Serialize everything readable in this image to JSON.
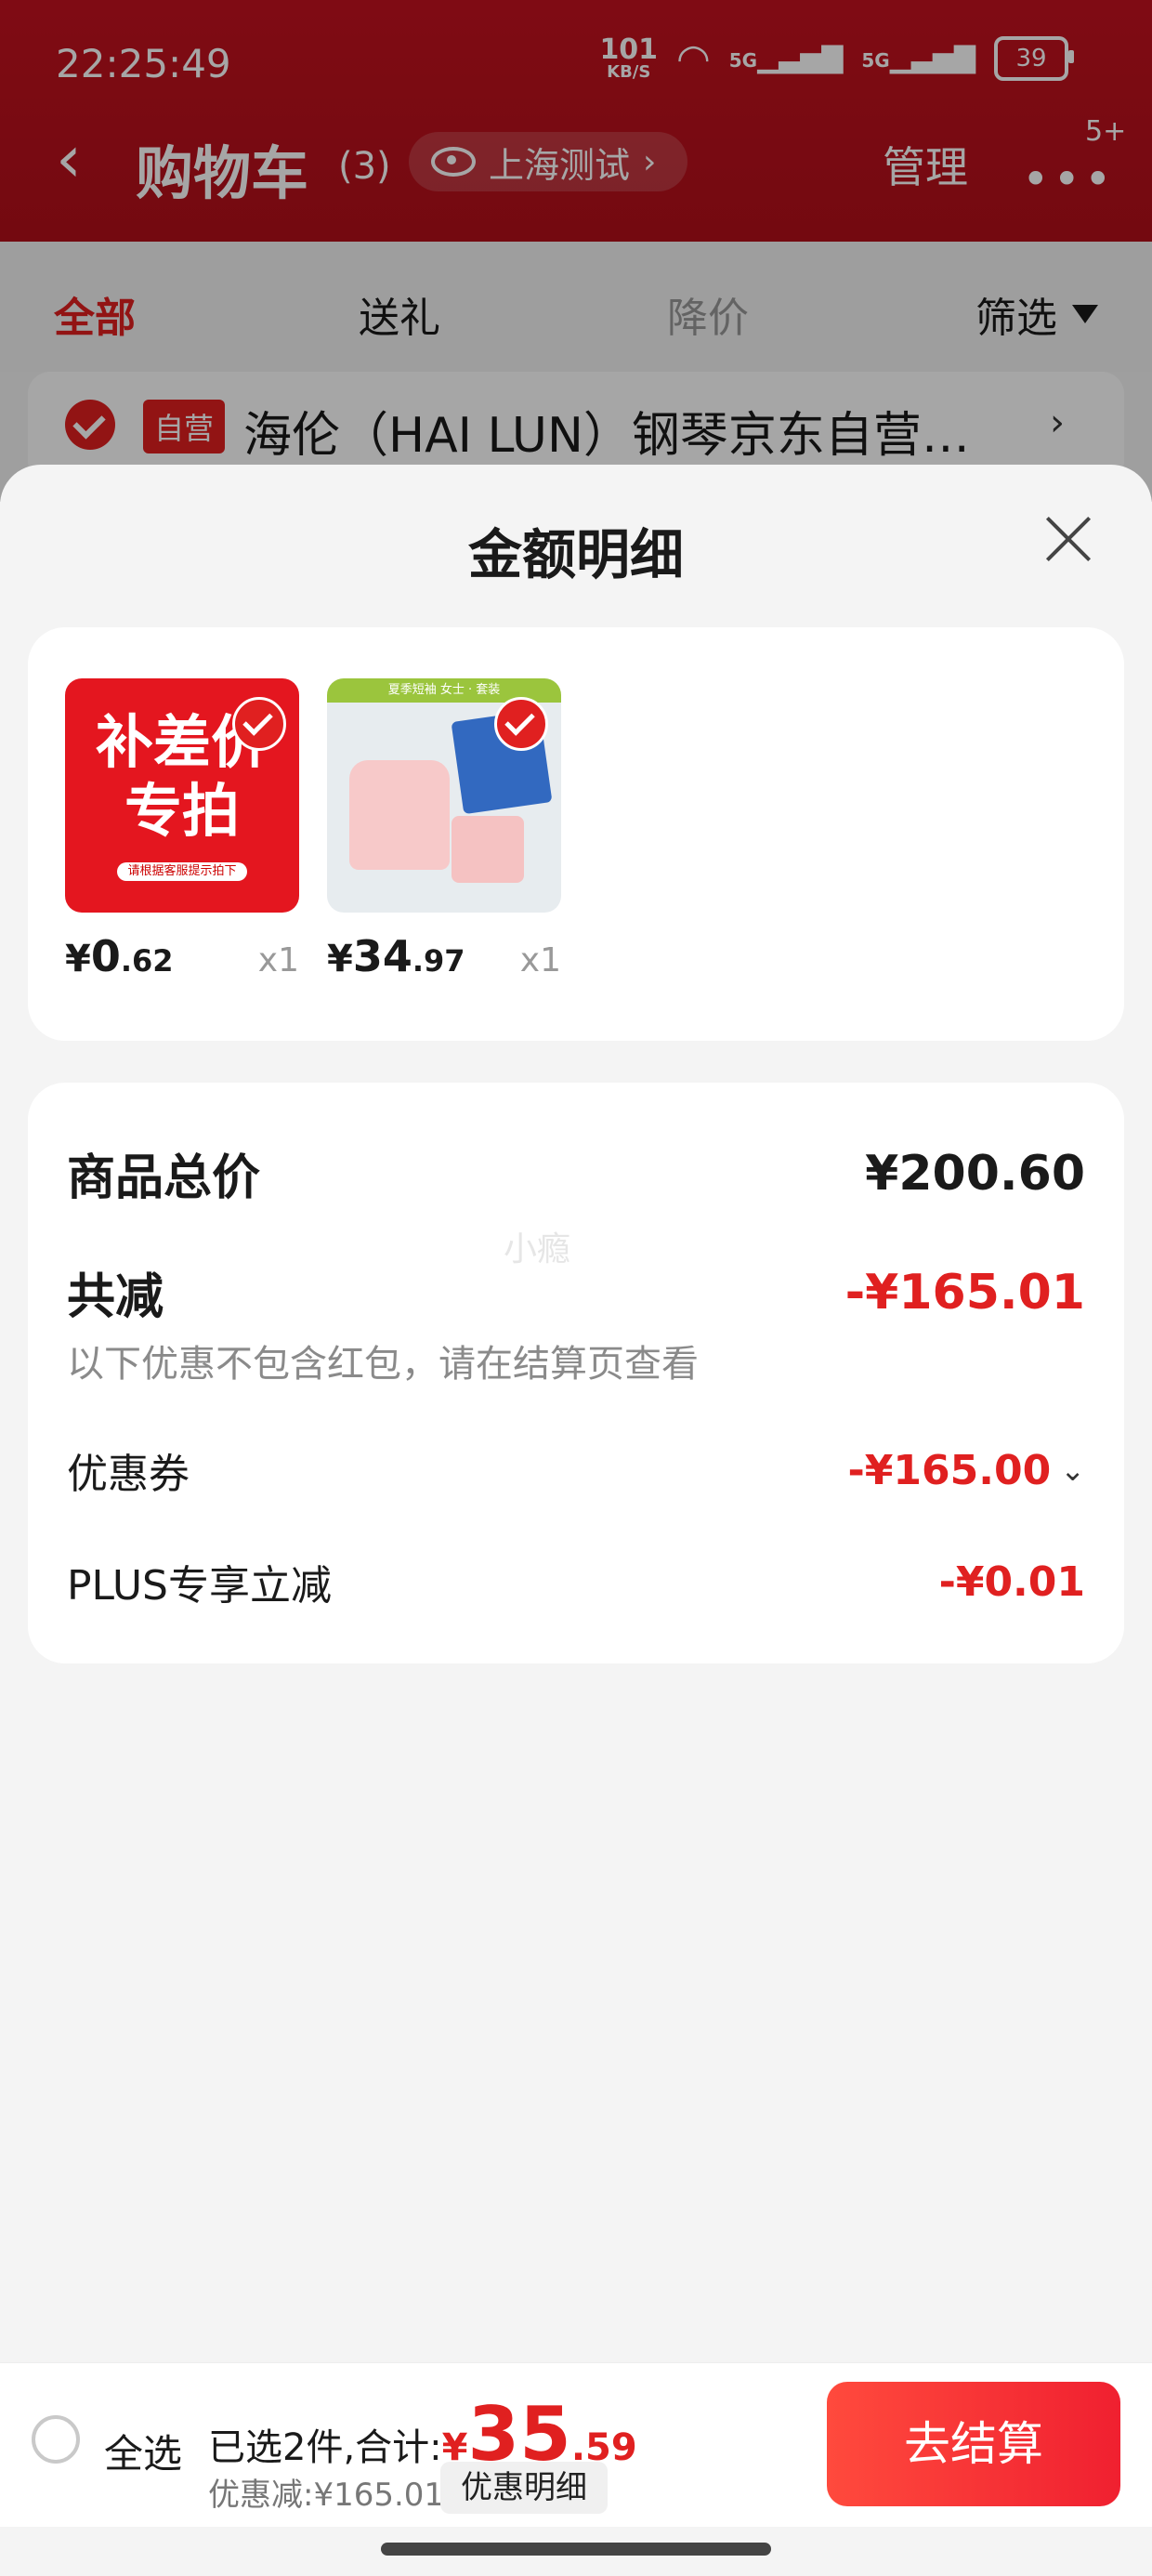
{
  "status_bar": {
    "time": "22:25:49",
    "net_speed_top": "101",
    "net_speed_unit": "KB/S",
    "signal1": "5G",
    "signal2": "5G",
    "battery": "39"
  },
  "header": {
    "back_icon": "chevron-left-icon",
    "title": "购物车",
    "count": "(3)",
    "location": "上海测试",
    "manage": "管理",
    "badge": "5+"
  },
  "tabs": [
    {
      "label": "全部",
      "state": "active"
    },
    {
      "label": "送礼",
      "state": "normal"
    },
    {
      "label": "降价",
      "state": "muted"
    },
    {
      "label": "筛选",
      "state": "normal"
    }
  ],
  "store": {
    "badge": "自营",
    "name": "海伦（HAI LUN）钢琴京东自营…"
  },
  "sheet": {
    "title": "金额明细",
    "products": [
      {
        "thumb_text_1": "补差价",
        "thumb_text_2": "专拍",
        "thumb_note": "请根据客服提示拍下",
        "price_yen": "¥",
        "price_int": "0",
        "price_cents": ".62",
        "qty": "x1"
      },
      {
        "thumb_band": "夏季短袖 女士 · 套装",
        "price_yen": "¥",
        "price_int": "34",
        "price_cents": ".97",
        "qty": "x1"
      }
    ],
    "summary": {
      "total_label": "商品总价",
      "total_value": "¥200.60",
      "watermark": "小瘾",
      "reduce_label": "共减",
      "reduce_value": "-¥165.01",
      "note": "以下优惠不包含红包，请在结算页查看",
      "coupon_label": "优惠券",
      "coupon_value": "-¥165.00",
      "plus_label": "PLUS专享立减",
      "plus_value": "-¥0.01"
    }
  },
  "bottom_bar": {
    "select_all": "全选",
    "selected_text": "已选2件,合计:",
    "total_yen": "¥",
    "total_int": "35",
    "total_cents": ".59",
    "discount_text": "优惠减:¥165.01",
    "detail_button": "优惠明细",
    "checkout_button": "去结算"
  },
  "colors": {
    "brand_red": "#e02020",
    "header_red": "#c4121f"
  }
}
